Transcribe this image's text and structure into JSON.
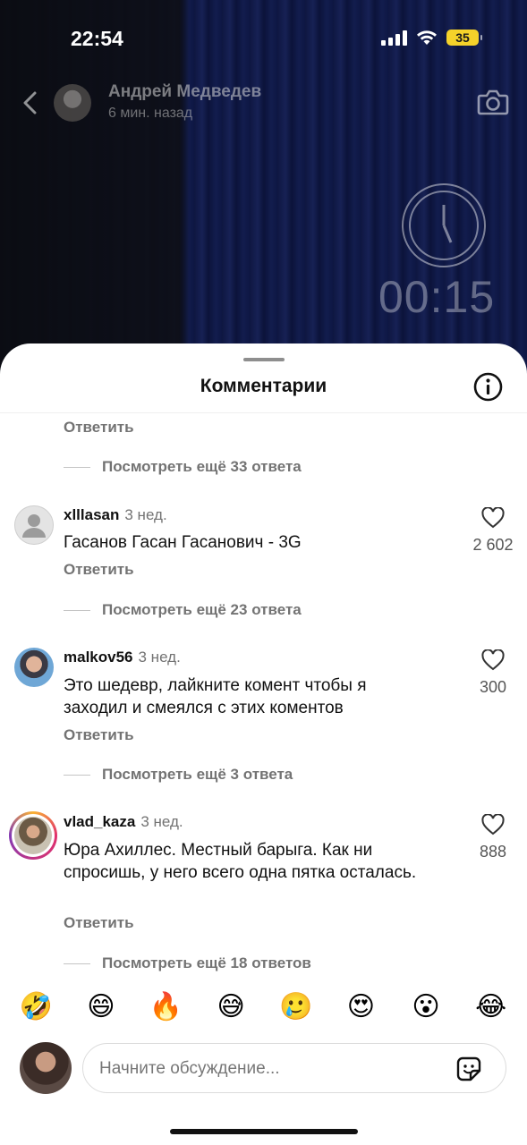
{
  "status_bar": {
    "time": "22:54",
    "battery": "35"
  },
  "story": {
    "author_name": "Андрей Медведев",
    "posted": "6 мин. назад",
    "timer": "00:15"
  },
  "sheet": {
    "title": "Комментарии"
  },
  "top_fragment": {
    "reply": "Ответить",
    "more": "Посмотреть ещё 33 ответа"
  },
  "comments": [
    {
      "user": "xlllasan",
      "time": "3 нед.",
      "text": "Гасанов Гасан Гасанович - 3G",
      "reply": "Ответить",
      "likes": "2 602",
      "more": "Посмотреть ещё 23 ответа"
    },
    {
      "user": "malkov56",
      "time": "3 нед.",
      "text": "Это шедевр, лайкните комент чтобы я заходил и смеялся с этих коментов",
      "reply": "Ответить",
      "likes": "300",
      "more": "Посмотреть ещё 3 ответа"
    },
    {
      "user": "vlad_kaza",
      "time": "3 нед.",
      "text": "Юра Ахиллес. Местный барыга. Как ни спросишь, у него всего одна пятка осталась.",
      "reply": "Ответить",
      "likes": "888",
      "more": "Посмотреть ещё 18 ответов"
    }
  ],
  "emojis": [
    "🤣",
    "😄",
    "🔥",
    "😅",
    "🥲",
    "😍",
    "😮",
    "😂"
  ],
  "input": {
    "placeholder": "Начните обсуждение..."
  },
  "colors": {
    "battery": "#f5d22a",
    "secondary_text": "#737373",
    "story_curtain": "#22358d"
  }
}
